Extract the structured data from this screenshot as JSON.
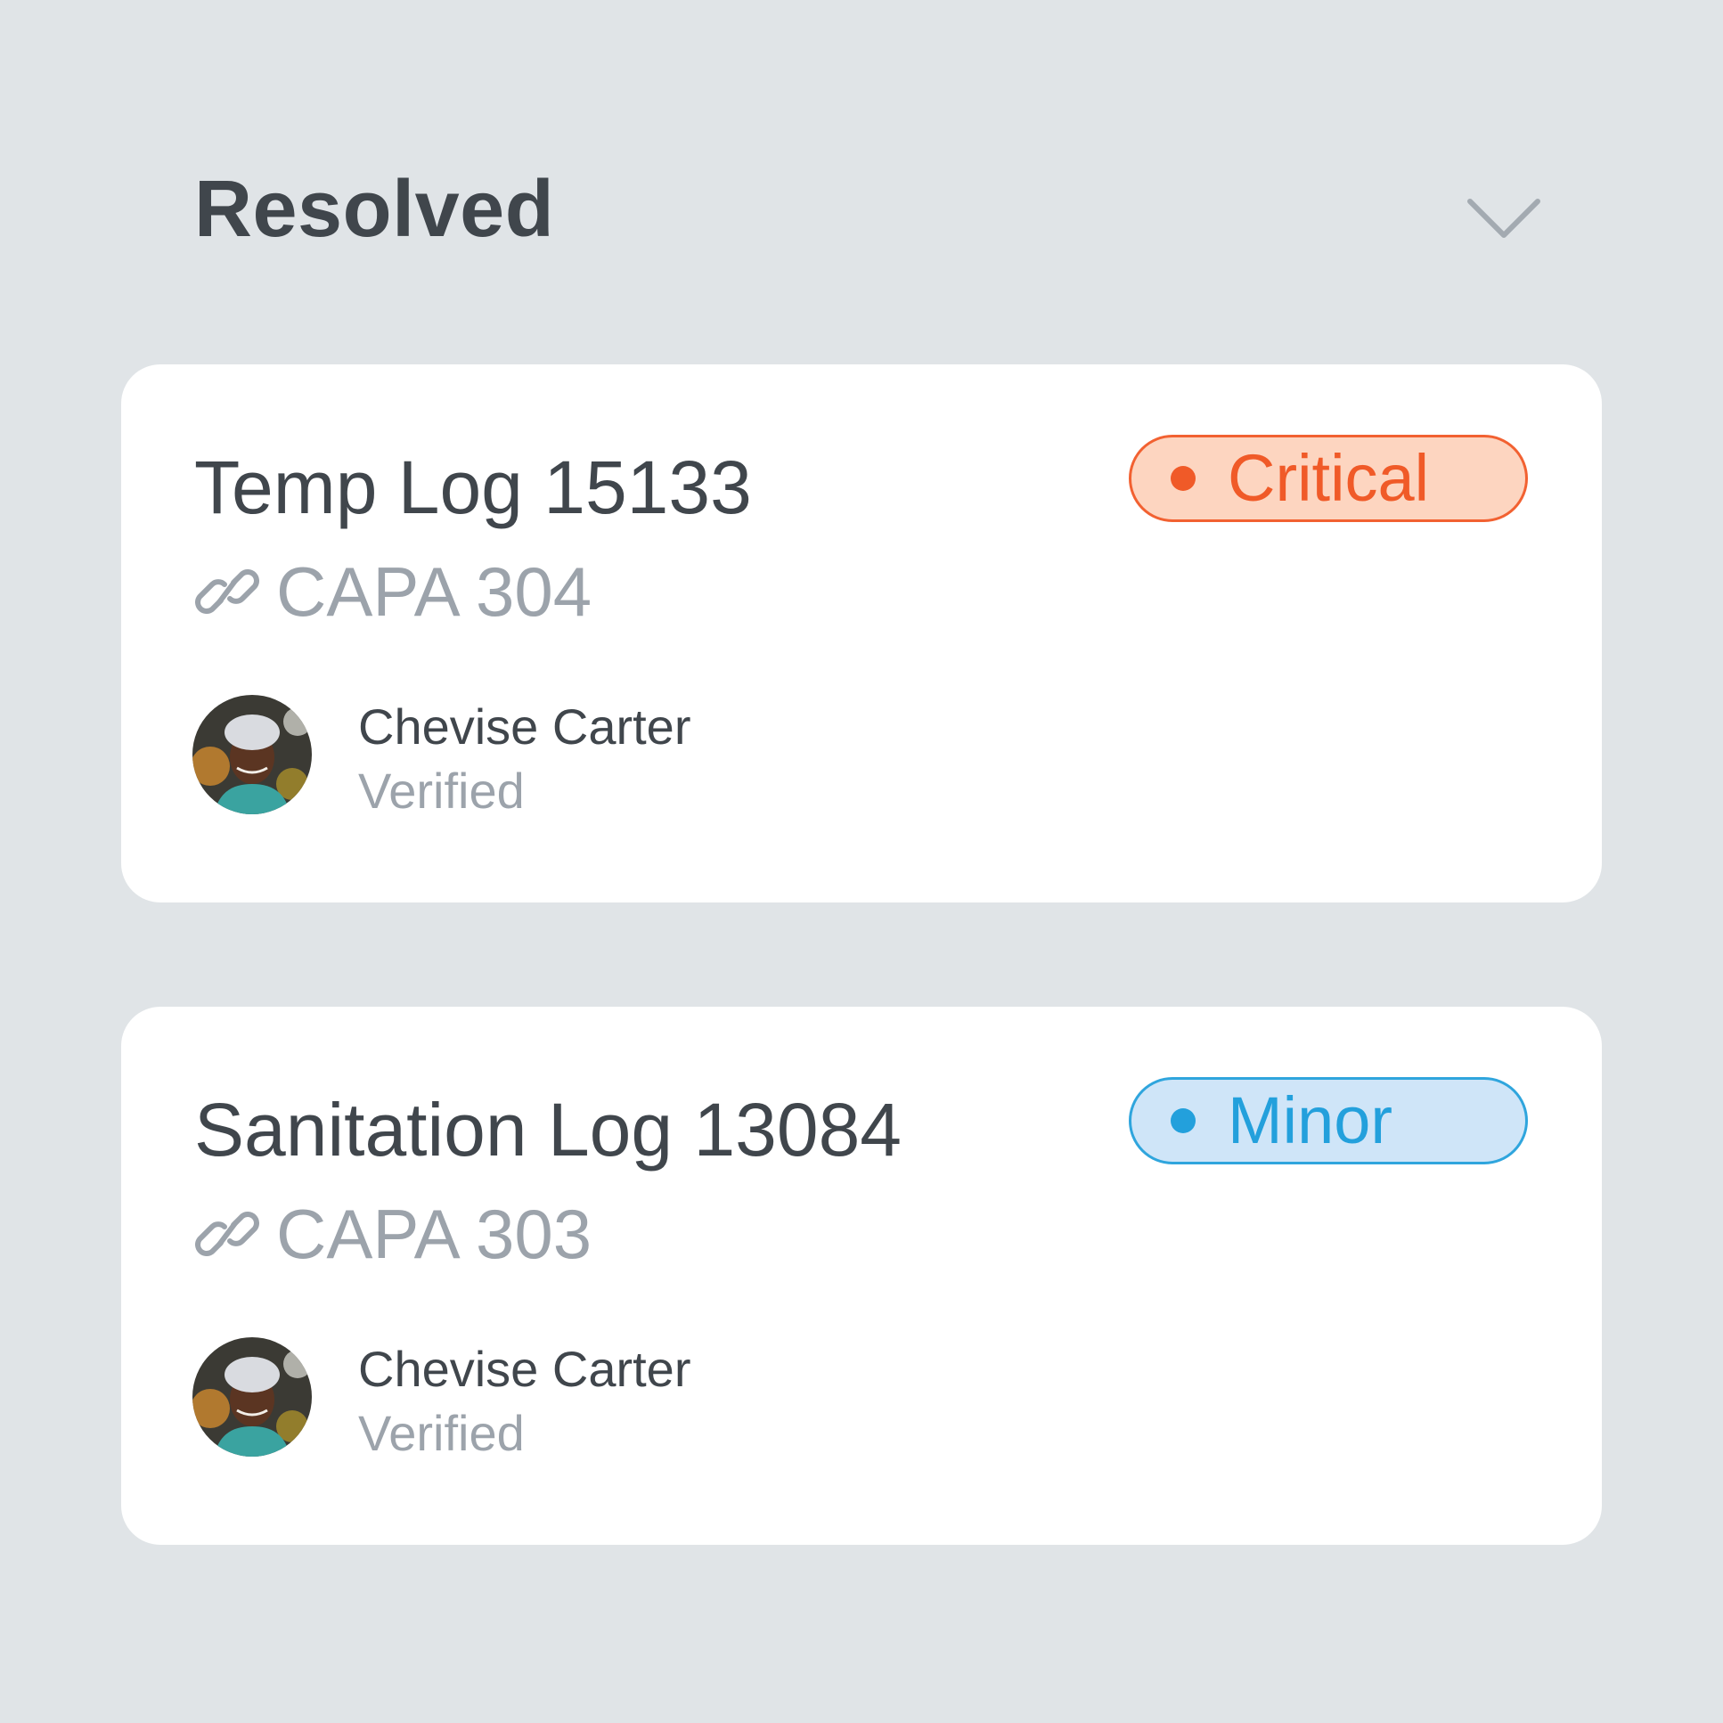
{
  "section": {
    "title": "Resolved",
    "toggle_icon": "chevron-down-icon"
  },
  "colors": {
    "background": "#e0e4e7",
    "card": "#ffffff",
    "text_primary": "#40464c",
    "text_secondary": "#9ca3ab",
    "critical": "#f05a28",
    "critical_bg": "#fdd5c0",
    "minor": "#23a0dc",
    "minor_bg": "#cfe5f8"
  },
  "cards": [
    {
      "title": "Temp Log 15133",
      "link_icon": "link-icon",
      "linked_item": "CAPA 304",
      "severity": "Critical",
      "person": {
        "name": "Chevise Carter",
        "status": "Verified"
      }
    },
    {
      "title": "Sanitation Log 13084",
      "link_icon": "link-icon",
      "linked_item": "CAPA 303",
      "severity": "Minor",
      "person": {
        "name": "Chevise Carter",
        "status": "Verified"
      }
    }
  ]
}
